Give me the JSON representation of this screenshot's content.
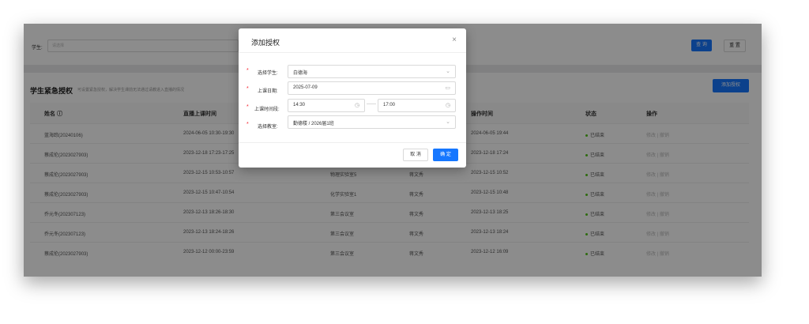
{
  "filter": {
    "label": "学生:",
    "placeholder": "请选择",
    "query_button": "查 询",
    "reset_button": "重 置"
  },
  "section": {
    "title": "学生紧急授权",
    "description": "可设置紧急授权，解决学生课前无法通过请教进入直播的情况",
    "add_button": "添加授权"
  },
  "table": {
    "columns": [
      "姓名 ⓘ",
      "直播上课时间",
      "",
      "",
      "操作时间",
      "状态",
      "操作"
    ],
    "rows": [
      {
        "name": "蓝海踪(20240106)",
        "time": "2024-06-05 10:30-19:30",
        "room": "",
        "teacher": "",
        "op_time": "2024-06-05 19:44",
        "status": "已结束",
        "ops": "修改 | 撤销"
      },
      {
        "name": "蔡成伦(2023027903)",
        "time": "2023-12-18 17:23-17:25",
        "room": "",
        "teacher": "",
        "op_time": "2023-12-18 17:24",
        "status": "已结束",
        "ops": "修改 | 撤销"
      },
      {
        "name": "蔡成伦(2023027903)",
        "time": "2023-12-15 10:53-10:57",
        "room": "物理实验室5",
        "teacher": "蒋文秀",
        "op_time": "2023-12-15 10:52",
        "status": "已结束",
        "ops": "修改 | 撤销"
      },
      {
        "name": "蔡成伦(2023027903)",
        "time": "2023-12-15 10:47-10:54",
        "room": "化学实验室1",
        "teacher": "蒋文秀",
        "op_time": "2023-12-15 10:48",
        "status": "已结束",
        "ops": "修改 | 撤销"
      },
      {
        "name": "乔元冬(202307123)",
        "time": "2023-12-13 18:26-18:30",
        "room": "第三会议室",
        "teacher": "蒋文秀",
        "op_time": "2023-12-13 18:25",
        "status": "已结束",
        "ops": "修改 | 撤销"
      },
      {
        "name": "乔元冬(202307123)",
        "time": "2023-12-13 18:24-18:26",
        "room": "第三会议室",
        "teacher": "蒋文秀",
        "op_time": "2023-12-13 18:24",
        "status": "已结束",
        "ops": "修改 | 撤销"
      },
      {
        "name": "蔡成伦(2023027903)",
        "time": "2023-12-12 00:00-23:59",
        "room": "第三会议室",
        "teacher": "蒋文秀",
        "op_time": "2023-12-12 16:09",
        "status": "已结束",
        "ops": "修改 | 撤销"
      }
    ]
  },
  "modal": {
    "title": "添加授权",
    "close_icon": "×",
    "fields": [
      {
        "label": "选择学生:",
        "value": "白德海"
      },
      {
        "label": "上课日期:",
        "value": "2025-07-09"
      },
      {
        "label": "上课时间段:",
        "start": "14:30",
        "end": "17:00"
      },
      {
        "label": "选择教室:",
        "value": "勤德楼 / 2026届1班"
      }
    ],
    "cancel_button": "取 消",
    "confirm_button": "确 定"
  },
  "colors": {
    "primary": "#1677ff",
    "success": "#52c41a",
    "required": "#f5222d"
  }
}
